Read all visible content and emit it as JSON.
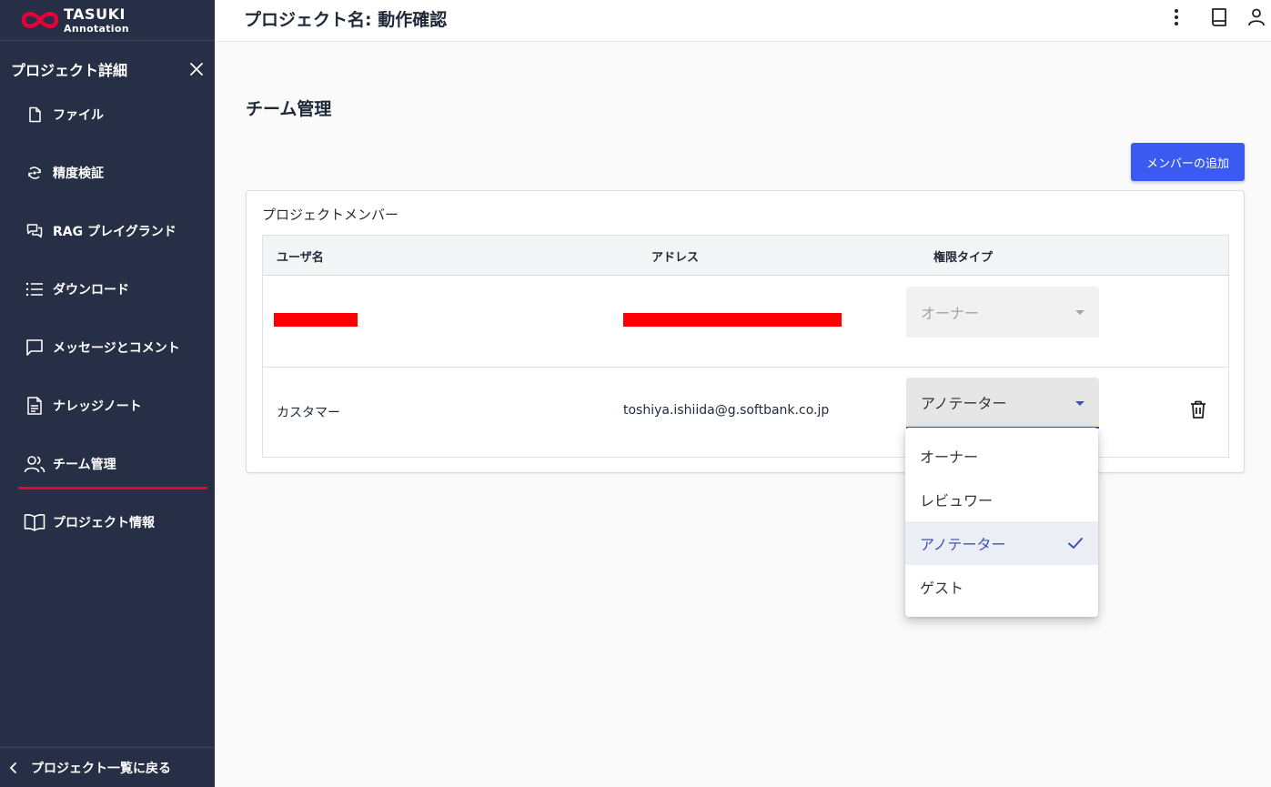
{
  "logo": {
    "line1": "TASUKI",
    "line2": "Annotation"
  },
  "sidebar": {
    "title": "プロジェクト詳細",
    "items": [
      {
        "label": "ファイル",
        "icon": "file-icon"
      },
      {
        "label": "精度検証",
        "icon": "accuracy-icon"
      },
      {
        "label": "RAG プレイグランド",
        "icon": "chat-bubbles-icon"
      },
      {
        "label": "ダウンロード",
        "icon": "list-icon"
      },
      {
        "label": "メッセージとコメント",
        "icon": "message-icon"
      },
      {
        "label": "ナレッジノート",
        "icon": "document-icon"
      },
      {
        "label": "チーム管理",
        "icon": "users-icon",
        "active": true
      },
      {
        "label": "プロジェクト情報",
        "icon": "book-open-icon"
      }
    ],
    "footer": {
      "label": "プロジェクト一覧に戻る",
      "icon": "chevron-left-icon"
    }
  },
  "header": {
    "project_title": "プロジェクト名: 動作確認"
  },
  "main": {
    "title": "チーム管理",
    "add_member_label": "メンバーの追加",
    "card_title": "プロジェクトメンバー",
    "columns": [
      "ユーザ名",
      "アドレス",
      "権限タイプ"
    ],
    "rows": [
      {
        "username": "",
        "address": "",
        "role": "オーナー",
        "redacted": true
      },
      {
        "username": "カスタマー",
        "address": "toshiya.ishiida@g.softbank.co.jp",
        "role": "アノテーター"
      }
    ]
  },
  "role_menu": {
    "options": [
      "オーナー",
      "レビュワー",
      "アノテーター",
      "ゲスト"
    ],
    "selected": "アノテーター"
  },
  "colors": {
    "sidebar_bg": "#262f45",
    "accent_red": "#e4003a",
    "button_blue": "#3b5bf0",
    "select_indigo": "#3f51b5"
  }
}
